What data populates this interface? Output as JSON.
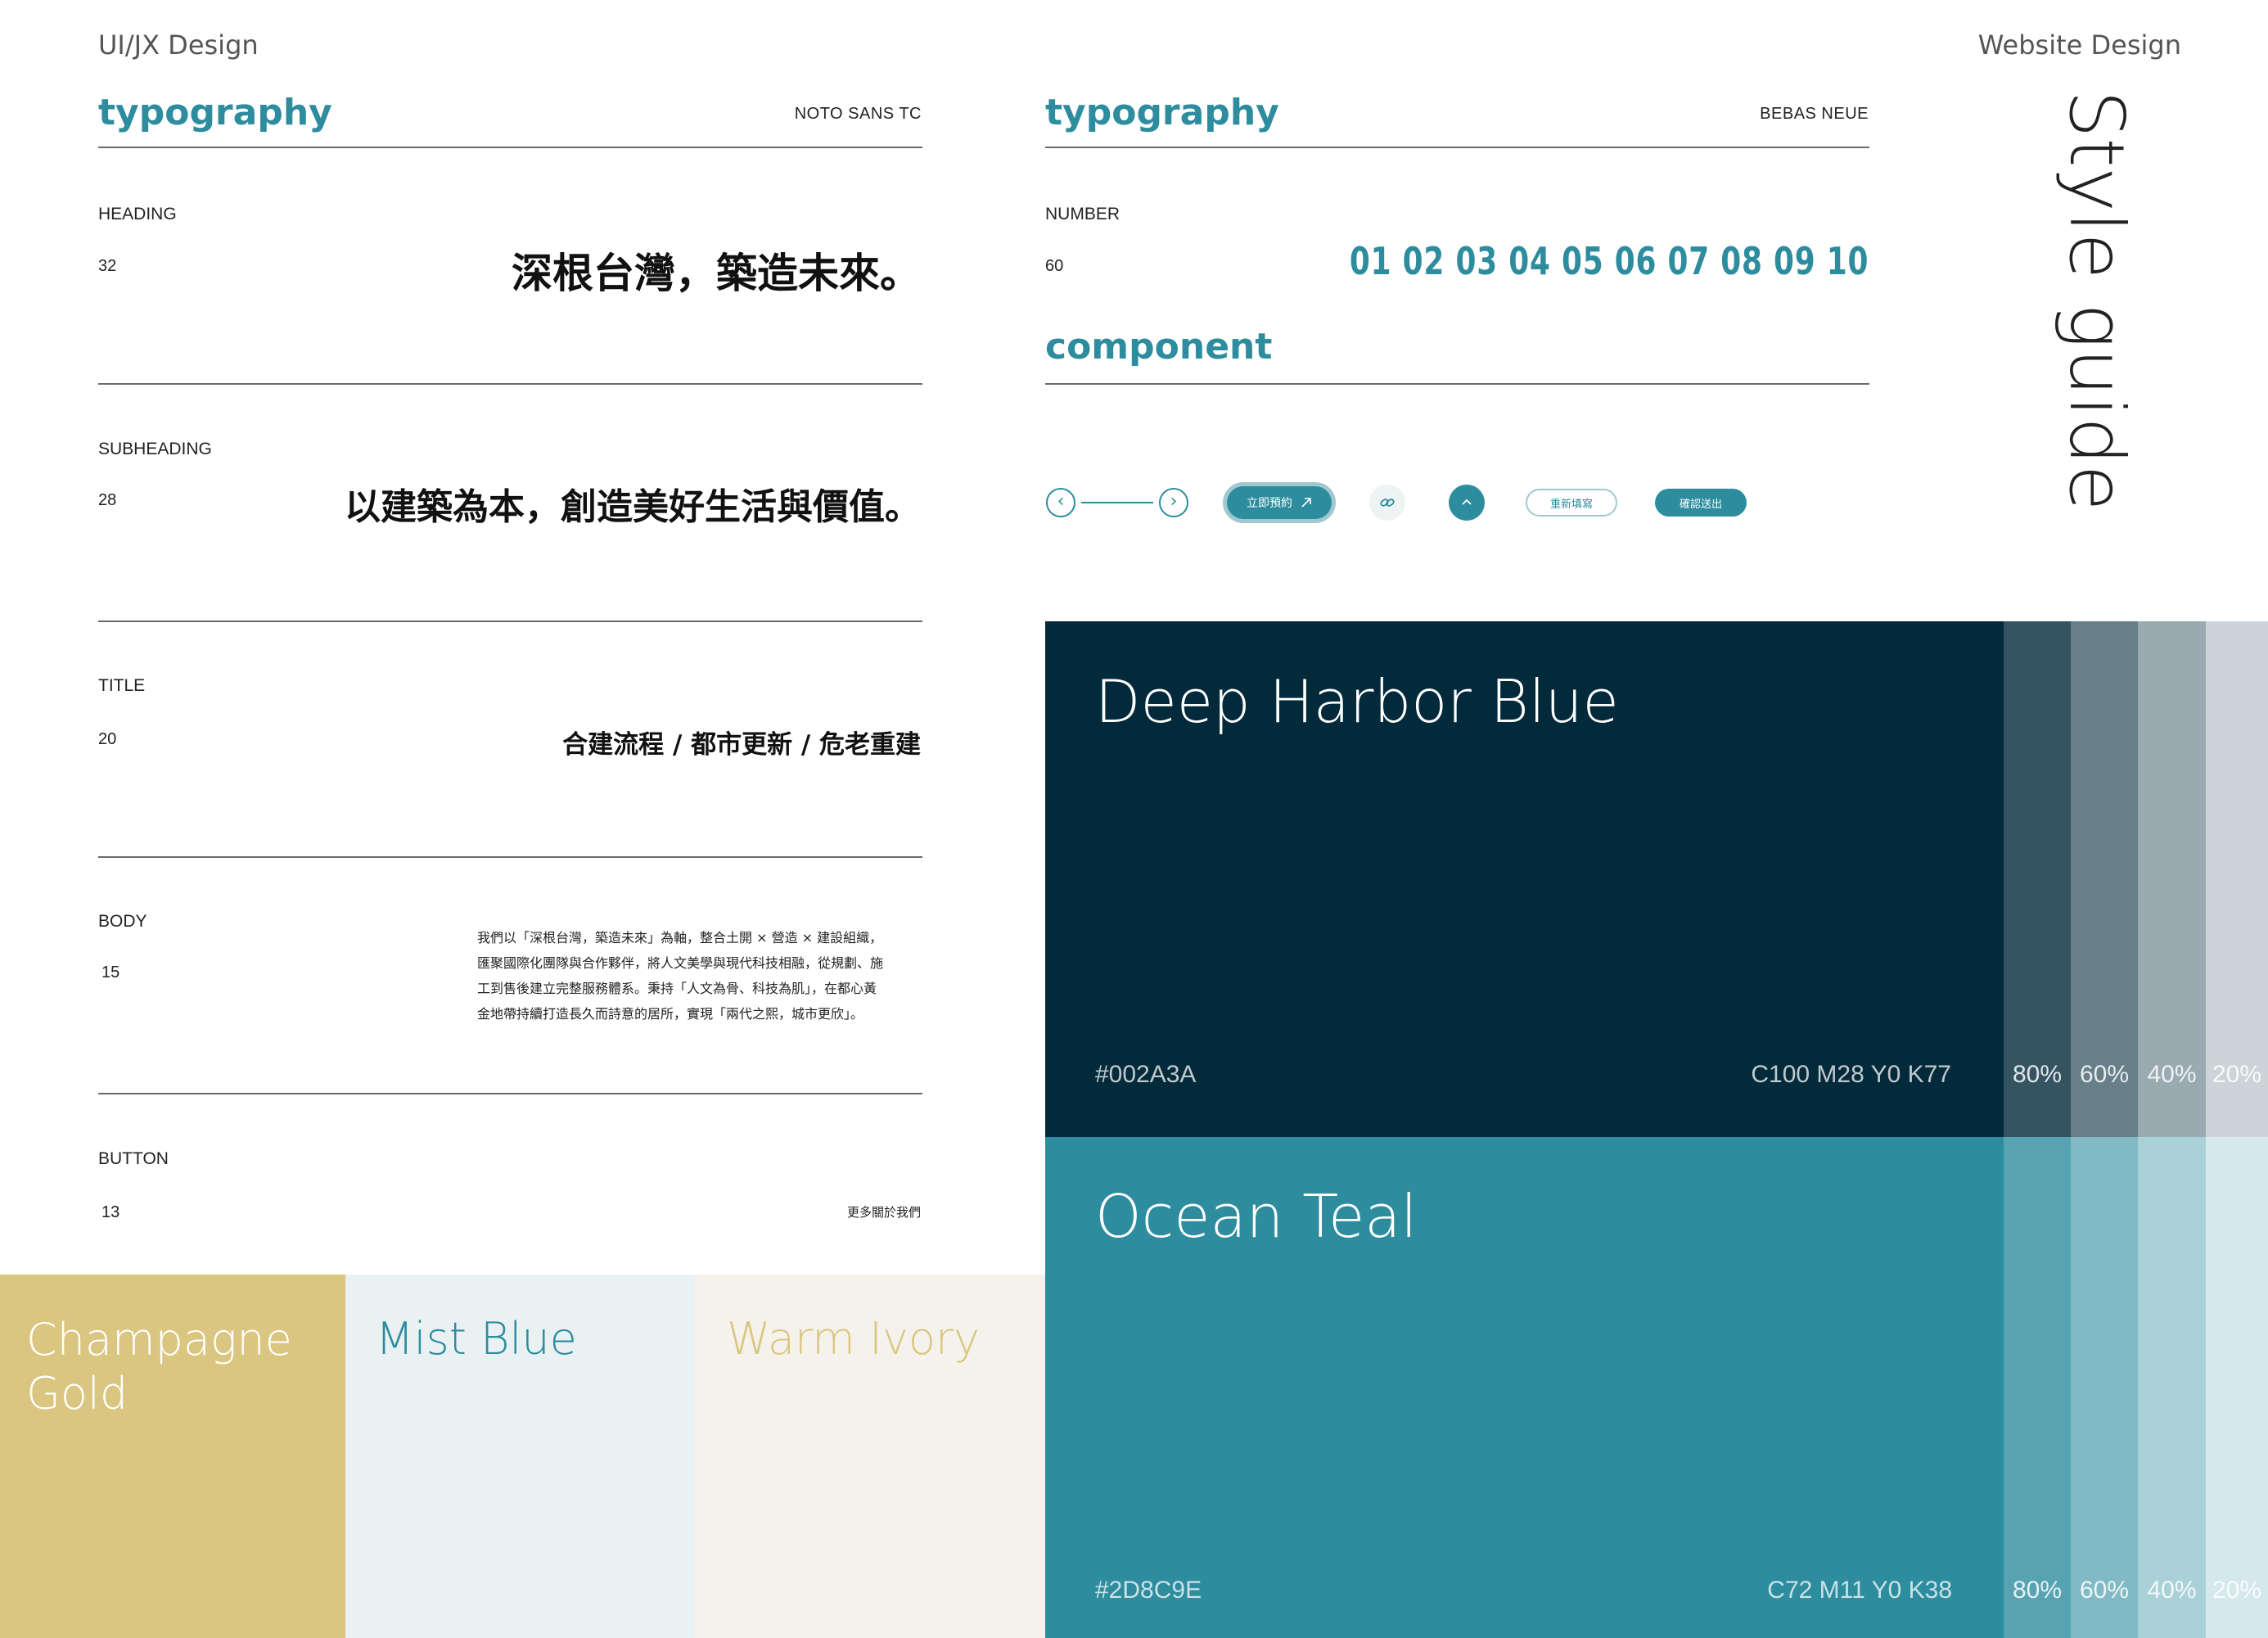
{
  "header": {
    "left": "UI/JX Design",
    "right": "Website Design",
    "vertical_title": "Style guide"
  },
  "typography_left": {
    "heading": "typography",
    "font_name": "NOTO SANS TC",
    "rows": [
      {
        "label": "HEADING",
        "size": "32",
        "sample": "深根台灣，築造未來。"
      },
      {
        "label": "SUBHEADING",
        "size": "28",
        "sample": "以建築為本，創造美好生活與價值。"
      },
      {
        "label": "TITLE",
        "size": "20",
        "sample": "合建流程 / 都市更新 / 危老重建"
      },
      {
        "label": "BODY",
        "size": "15",
        "sample_lines": [
          "我們以「深根台灣，築造未來」為軸，整合土開 × 營造 × 建設組織，",
          "匯聚國際化團隊與合作夥伴，將人文美學與現代科技相融，從規劃、施",
          "工到售後建立完整服務體系。秉持「人文為骨、科技為肌」，在都心黃",
          "金地帶持續打造長久而詩意的居所，實現「兩代之熙，城市更欣」。"
        ]
      },
      {
        "label": "BUTTON",
        "size": "13",
        "sample": "更多關於我們"
      }
    ]
  },
  "typography_right": {
    "heading": "typography",
    "font_name": "BEBAS NEUE",
    "label": "NUMBER",
    "size": "60",
    "numbers": "01 02 03 04 05 06 07 08 09 10"
  },
  "component": {
    "heading": "component",
    "arrow_left": "‹",
    "arrow_right": "›",
    "primary_button": "立即預約",
    "primary_button_icon": "arrow-up-right-icon",
    "link_icon": "link-icon",
    "scroll_top_icon": "chevron-up-icon",
    "reset_button": "重新填寫",
    "submit_button": "確認送出"
  },
  "colors": {
    "deep_harbor_blue": {
      "name": "Deep Harbor Blue",
      "hex": "#002A3A",
      "cmyk": "C100 M28 Y0 K77",
      "tints": [
        "80%",
        "60%",
        "40%",
        "20%"
      ],
      "color": "#022A3A"
    },
    "ocean_teal": {
      "name": "Ocean Teal",
      "hex": "#2D8C9E",
      "cmyk": "C72 M11 Y0 K38",
      "tints": [
        "80%",
        "60%",
        "40%",
        "20%"
      ],
      "color": "#2D8C9E"
    },
    "champagne_gold": {
      "name_line1": "Champagne",
      "name_line2": "Gold",
      "color": "#DAC680"
    },
    "mist_blue": {
      "name": "Mist Blue",
      "color": "#E9F1F3",
      "text_color": "#2D8C9E"
    },
    "warm_ivory": {
      "name": "Warm Ivory",
      "color": "#F5F2EC",
      "text_color": "#DAC680"
    }
  }
}
